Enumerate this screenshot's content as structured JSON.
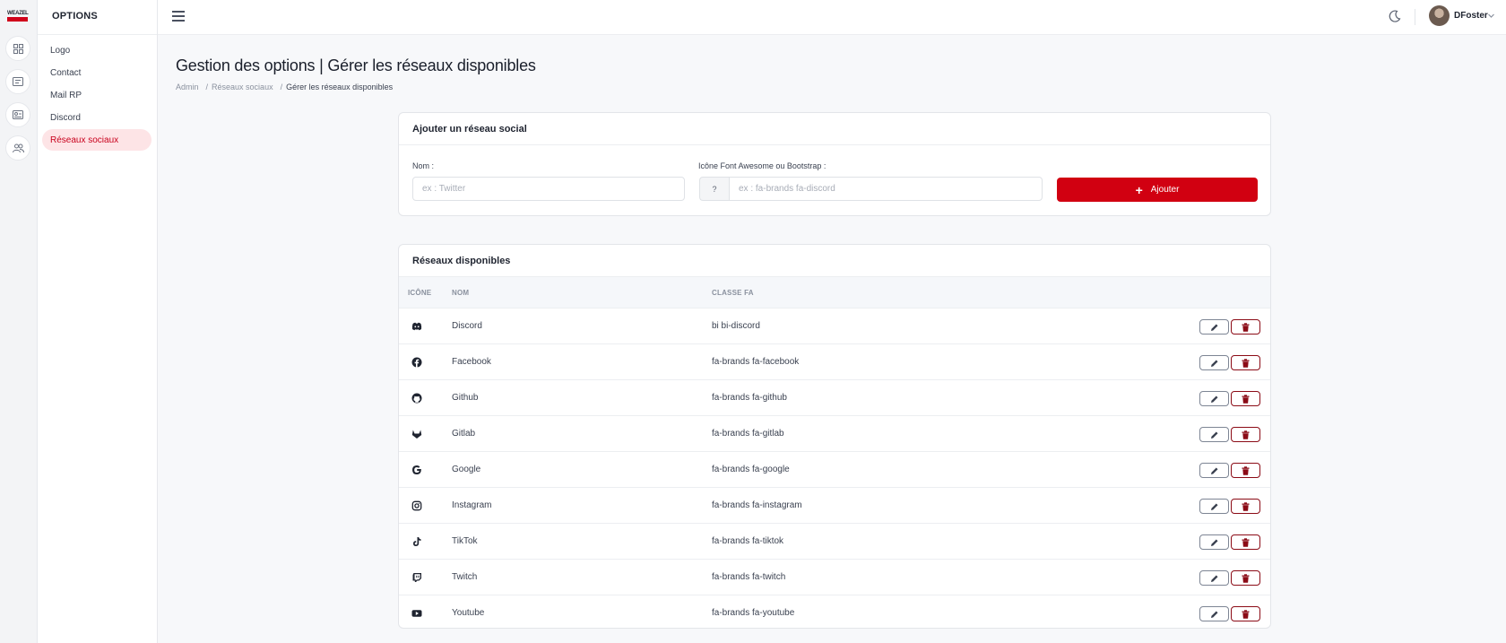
{
  "app": {
    "logo_text": "WEAZEL"
  },
  "sidebar": {
    "title": "OPTIONS",
    "items": [
      {
        "label": "Logo"
      },
      {
        "label": "Contact"
      },
      {
        "label": "Mail RP"
      },
      {
        "label": "Discord"
      },
      {
        "label": "Réseaux sociaux",
        "active": true
      }
    ]
  },
  "topbar": {
    "username": "DFoster"
  },
  "page": {
    "title": "Gestion des options | Gérer les réseaux disponibles",
    "breadcrumb": [
      "Admin",
      "Réseaux sociaux",
      "Gérer les réseaux disponibles"
    ]
  },
  "add_form": {
    "title": "Ajouter un réseau social",
    "name_label": "Nom :",
    "name_placeholder": "ex : Twitter",
    "name_value": "",
    "icon_label": "Icône Font Awesome ou Bootstrap :",
    "icon_preview": "?",
    "icon_placeholder": "ex : fa-brands fa-discord",
    "icon_value": "",
    "submit_label": "Ajouter"
  },
  "networks": {
    "title": "Réseaux disponibles",
    "columns": [
      "ICÔNE",
      "NOM",
      "CLASSE FA"
    ],
    "rows": [
      {
        "icon": "discord-icon",
        "name": "Discord",
        "class": "bi bi-discord"
      },
      {
        "icon": "facebook-icon",
        "name": "Facebook",
        "class": "fa-brands fa-facebook"
      },
      {
        "icon": "github-icon",
        "name": "Github",
        "class": "fa-brands fa-github"
      },
      {
        "icon": "gitlab-icon",
        "name": "Gitlab",
        "class": "fa-brands fa-gitlab"
      },
      {
        "icon": "google-icon",
        "name": "Google",
        "class": "fa-brands fa-google"
      },
      {
        "icon": "instagram-icon",
        "name": "Instagram",
        "class": "fa-brands fa-instagram"
      },
      {
        "icon": "tiktok-icon",
        "name": "TikTok",
        "class": "fa-brands fa-tiktok"
      },
      {
        "icon": "twitch-icon",
        "name": "Twitch",
        "class": "fa-brands fa-twitch"
      },
      {
        "icon": "youtube-icon",
        "name": "Youtube",
        "class": "fa-brands fa-youtube"
      }
    ]
  },
  "colors": {
    "accent": "#d10011",
    "active_bg": "#fde4e6",
    "delete_border": "#8b0b16"
  }
}
